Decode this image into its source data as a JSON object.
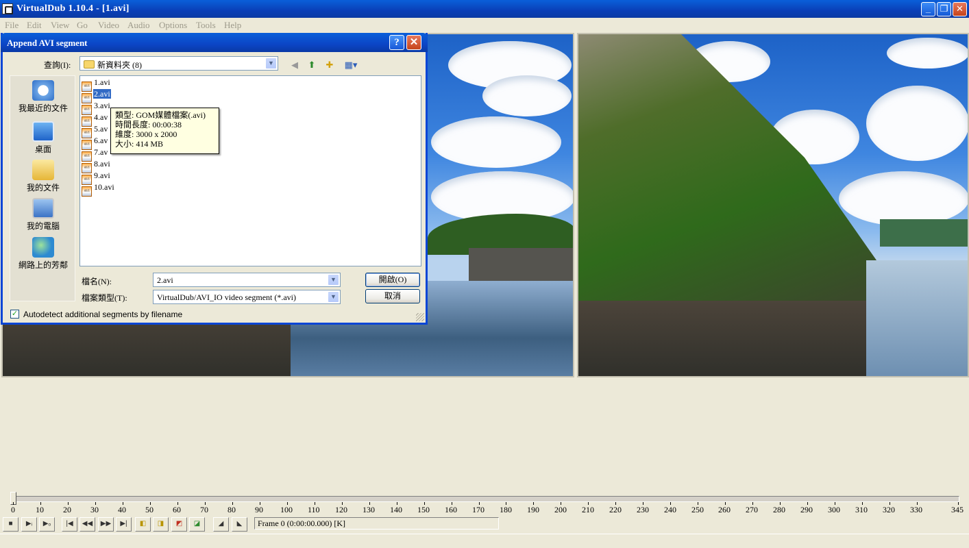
{
  "window": {
    "title": "VirtualDub 1.10.4 - [1.avi]",
    "icon": "virtualdub-icon",
    "controls": [
      "_",
      "❐",
      "✕"
    ]
  },
  "menu": [
    "File",
    "Edit",
    "View",
    "Go",
    "Video",
    "Audio",
    "Options",
    "Tools",
    "Help"
  ],
  "dialog": {
    "title": "Append AVI segment",
    "help_label": "?",
    "close_label": "✕",
    "look_in_label": "查詢(I):",
    "look_in_value": "新資料夾 (8)",
    "toolbar_icons": [
      "back-icon",
      "up-folder-icon",
      "new-folder-icon",
      "view-menu-icon"
    ],
    "places": [
      "我最近的文件",
      "桌面",
      "我的文件",
      "我的電腦",
      "網路上的芳鄰"
    ],
    "files": [
      "1.avi",
      "2.avi",
      "3.avi",
      "4.avi",
      "5.avi",
      "6.avi",
      "7.avi",
      "8.avi",
      "9.avi",
      "10.avi"
    ],
    "file_partial": [
      "1.avi",
      "2.avi",
      "3.avi",
      "4.av",
      "5.av",
      "6.av",
      "7.av",
      "8.avi",
      "9.avi",
      "10.avi"
    ],
    "selected_file": "2.avi",
    "tooltip": [
      "類型: GOM媒體檔案(.avi)",
      "時間長度: 00:00:38",
      "維度: 3000 x 2000",
      "大小: 414 MB"
    ],
    "filename_label": "檔名(N):",
    "filename_value": "2.avi",
    "filetype_label": "檔案類型(T):",
    "filetype_value": "VirtualDub/AVI_IO video segment (*.avi)",
    "open_label": "開啟(O)",
    "cancel_label": "取消",
    "autodetect_label": "Autodetect additional segments by filename",
    "autodetect_checked": true
  },
  "timeline": {
    "ticks": [
      "0",
      "10",
      "20",
      "30",
      "40",
      "50",
      "60",
      "70",
      "80",
      "90",
      "100",
      "110",
      "120",
      "130",
      "140",
      "150",
      "160",
      "170",
      "180",
      "190",
      "200",
      "210",
      "220",
      "230",
      "240",
      "250",
      "260",
      "270",
      "280",
      "290",
      "300",
      "310",
      "320",
      "330",
      "345"
    ],
    "position": 0,
    "max": 345
  },
  "toolbar": {
    "buttons": [
      "stop-icon",
      "play-input-icon",
      "play-output-icon",
      "start-icon",
      "prev-key-icon",
      "next-key-icon",
      "end-icon",
      "scene-back-icon",
      "scene-fwd-icon",
      "mark-in-icon",
      "mark-out-icon",
      "mark-in-arrow-icon",
      "mark-out-arrow-icon"
    ],
    "frame_text": "Frame 0 (0:00:00.000) [K]"
  },
  "colors": {
    "titlebar": "#0a3fb7",
    "selection": "#316ac5",
    "tooltip_bg": "#ffffe1",
    "window_bg": "#ece9d8"
  }
}
